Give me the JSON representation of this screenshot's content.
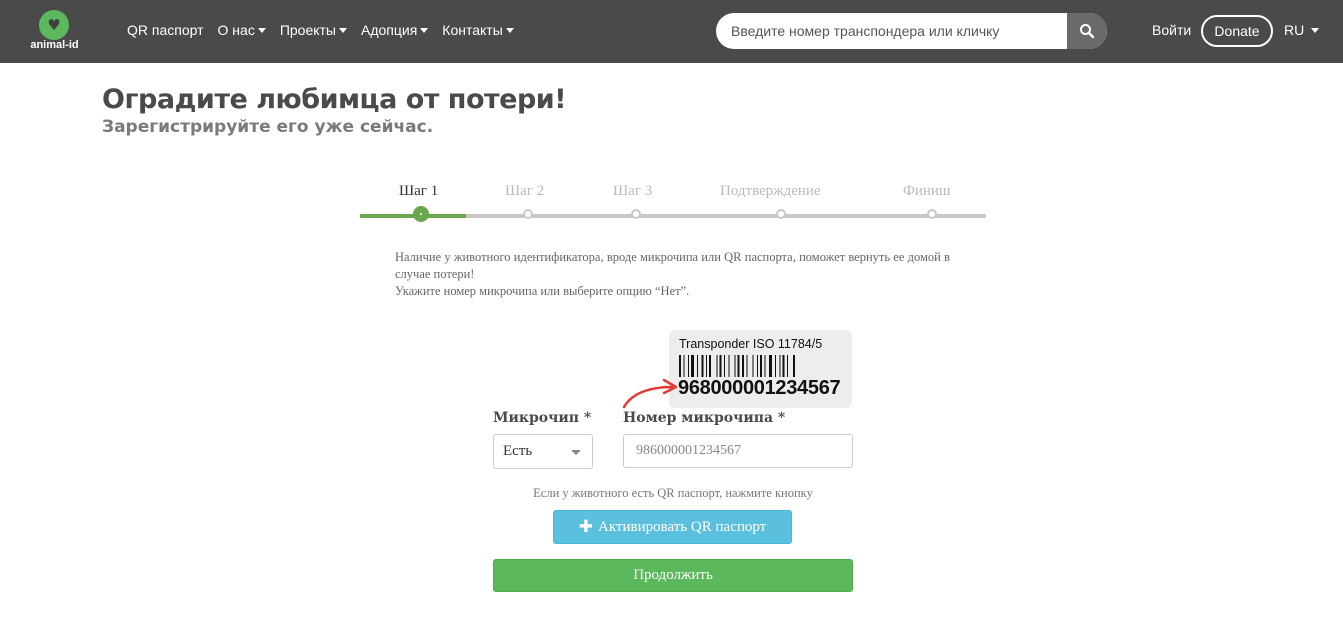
{
  "brand": {
    "name": "animal-id",
    "color": "#5cb85c"
  },
  "nav": {
    "items": [
      {
        "label": "QR паспорт",
        "dropdown": false
      },
      {
        "label": "О нас",
        "dropdown": true
      },
      {
        "label": "Проекты",
        "dropdown": true
      },
      {
        "label": "Адопция",
        "dropdown": true
      },
      {
        "label": "Контакты",
        "dropdown": true
      }
    ],
    "search_placeholder": "Введите номер транспондера или кличку",
    "login": "Войти",
    "donate": "Donate",
    "lang": "RU"
  },
  "page": {
    "title": "Оградите любимца от потери!",
    "subtitle": "Зарегистрируйте его уже сейчас."
  },
  "steps": {
    "items": [
      "Шаг 1",
      "Шаг 2",
      "Шаг 3",
      "Подтверждение",
      "Финиш"
    ],
    "active_index": 0
  },
  "description": {
    "line1": "Наличие у животного идентификатора, вроде микрочипа или QR паспорта, поможет вернуть ее домой в случае потери!",
    "line2": "Укажите номер микрочипа или выберите опцию “Нет”."
  },
  "transponder_example": {
    "title": "Transponder ISO 11784/5",
    "number": "968000001234567"
  },
  "form": {
    "microchip_label": "Микрочип *",
    "microchip_value": "Есть",
    "number_label": "Номер микрочипа *",
    "number_placeholder": "986000001234567",
    "qr_hint": "Если у животного есть QR паспорт, нажмите кнопку",
    "qr_button": "Активировать QR паспорт",
    "continue_button": "Продолжить"
  },
  "colors": {
    "nav_bg": "#4a4a4a",
    "accent_green": "#5cb85c",
    "info_blue": "#5bc0de",
    "arrow_red": "#e53935"
  }
}
